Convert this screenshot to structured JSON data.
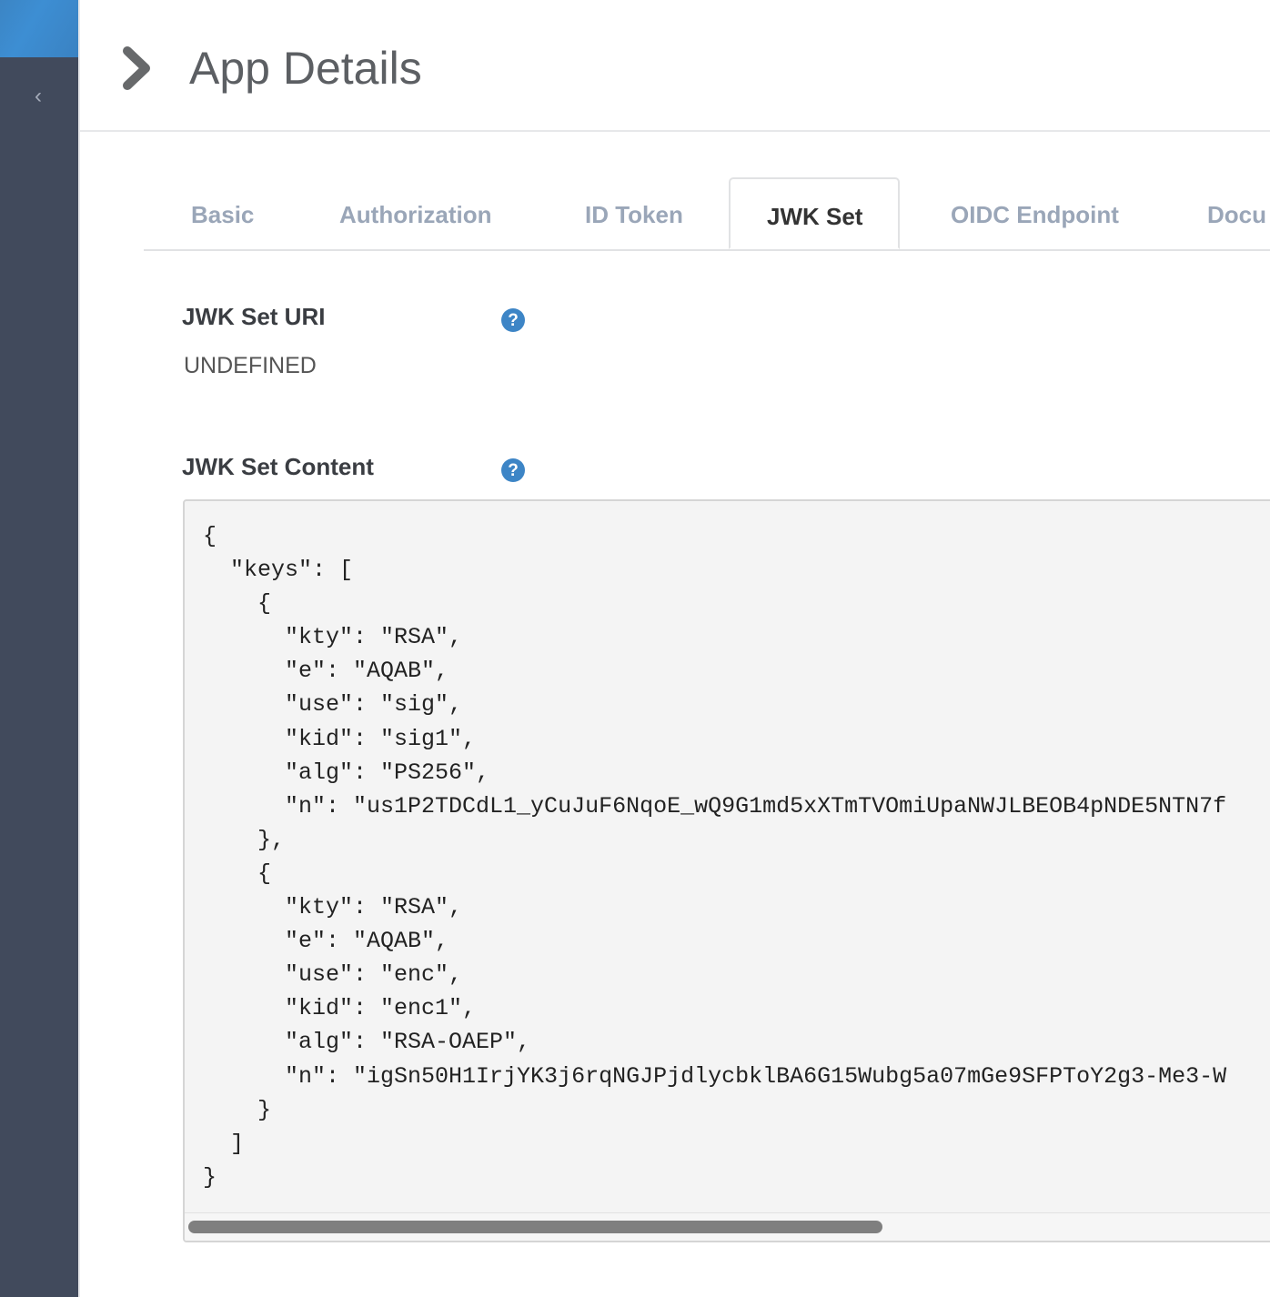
{
  "header": {
    "title": "App Details"
  },
  "tabs": [
    "Basic",
    "Authorization",
    "ID Token",
    "JWK Set",
    "OIDC Endpoint",
    "Docu"
  ],
  "jwk_set_uri": {
    "label": "JWK Set URI",
    "value": "UNDEFINED",
    "help": "?"
  },
  "jwk_set_content": {
    "label": "JWK Set Content",
    "help": "?",
    "lines": [
      "{",
      "  \"keys\": [",
      "    {",
      "      \"kty\": \"RSA\",",
      "      \"e\": \"AQAB\",",
      "      \"use\": \"sig\",",
      "      \"kid\": \"sig1\",",
      "      \"alg\": \"PS256\",",
      "      \"n\": \"us1P2TDCdL1_yCuJuF6NqoE_wQ9G1md5xXTmTVOmiUpaNWJLBEOB4pNDE5NTN7f",
      "    },",
      "    {",
      "      \"kty\": \"RSA\",",
      "      \"e\": \"AQAB\",",
      "      \"use\": \"enc\",",
      "      \"kid\": \"enc1\",",
      "      \"alg\": \"RSA-OAEP\",",
      "      \"n\": \"igSn50H1IrjYK3j6rqNGJPjdlycbklBA6G15Wubg5a07mGe9SFPToY2g3-Me3-W",
      "    }",
      "  ]",
      "}"
    ]
  }
}
